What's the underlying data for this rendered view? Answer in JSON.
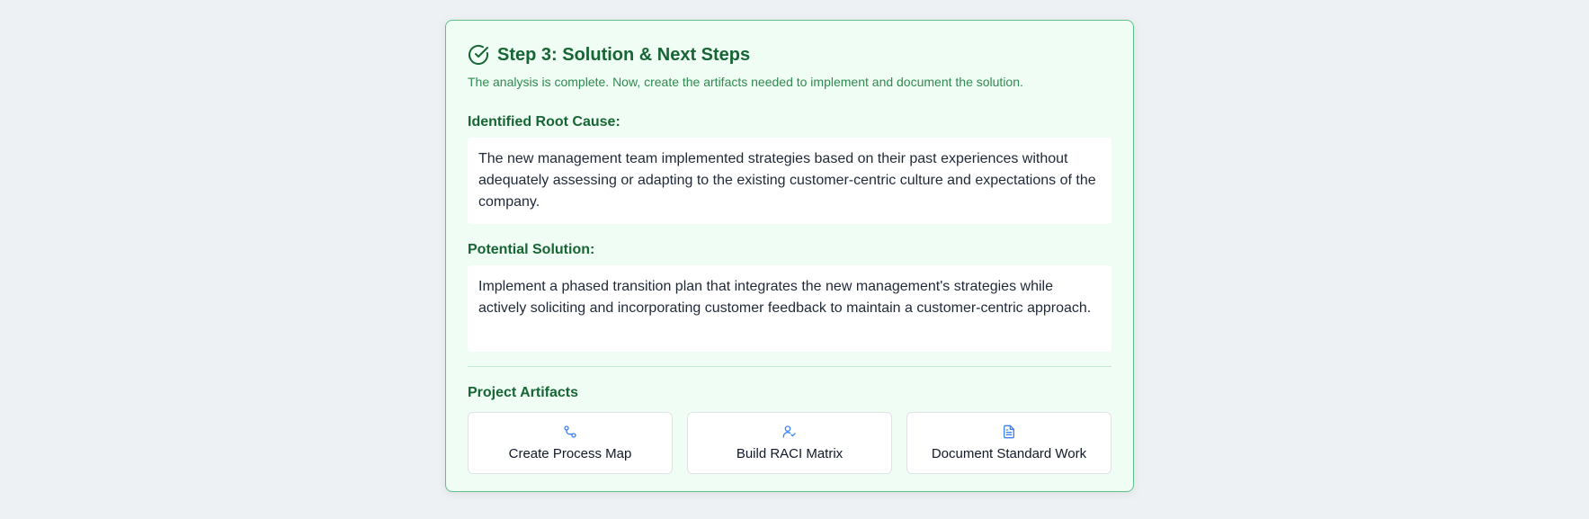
{
  "step": {
    "title": "Step 3: Solution & Next Steps",
    "subtitle": "The analysis is complete. Now, create the artifacts needed to implement and document the solution.",
    "icon": "check-circle-icon"
  },
  "root_cause": {
    "label": "Identified Root Cause:",
    "text": "The new management team implemented strategies based on their past experiences without adequately assessing or adapting to the existing customer-centric culture and expectations of the company."
  },
  "solution": {
    "label": "Potential Solution:",
    "text": "Implement a phased transition plan that integrates the new management's strategies while actively soliciting and incorporating customer feedback to maintain a customer-centric approach."
  },
  "artifacts": {
    "title": "Project Artifacts",
    "items": [
      {
        "label": "Create Process Map",
        "icon": "process-map-icon"
      },
      {
        "label": "Build RACI Matrix",
        "icon": "user-check-icon"
      },
      {
        "label": "Document Standard Work",
        "icon": "document-icon"
      }
    ]
  },
  "colors": {
    "accent_green": "#166534",
    "icon_blue": "#3b82f6",
    "card_bg": "#f0fdf4",
    "card_border": "#5fc08a"
  }
}
